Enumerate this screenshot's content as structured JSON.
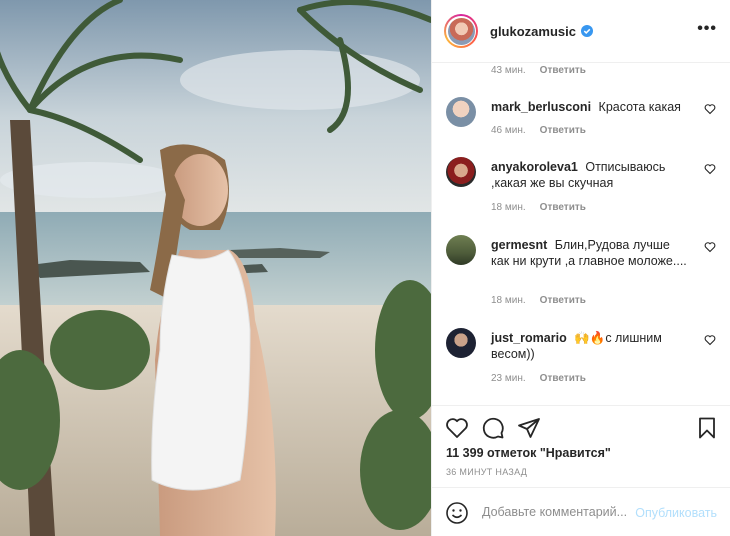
{
  "post": {
    "image_alt": "beach photo",
    "colors": {
      "sky": "#aebfcc",
      "sea": "#9fb5bc",
      "sand": "#d8cfc2",
      "swimsuit": "#f4f4f4"
    }
  },
  "header": {
    "username": "glukozamusic",
    "verified_icon": "verified-badge-icon",
    "more_icon": "more-options-icon",
    "more_glyph": "•••"
  },
  "comments": {
    "top_item": {
      "time": "43 мин.",
      "reply": "Ответить"
    },
    "items": [
      {
        "user": "mark_berlusconi",
        "text": "Красота какая",
        "time": "46 мин.",
        "reply": "Ответить"
      },
      {
        "user": "anyakoroleva1",
        "text": "Отписываюсь ,какая же вы скучная",
        "time": "18 мин.",
        "reply": "Ответить"
      },
      {
        "user": "germesnt",
        "text": "Блин,Рудова лучше как ни крути ,а главное моложе....",
        "time": "18 мин.",
        "reply": "Ответить"
      },
      {
        "user": "just_romario",
        "text": "🙌🔥с лишним весом))",
        "time": "23 мин.",
        "reply": "Ответить"
      }
    ]
  },
  "actions": {
    "like_icon": "heart-icon",
    "comment_icon": "comment-icon",
    "share_icon": "share-icon",
    "save_icon": "bookmark-icon",
    "likes": "11 399 отметок \"Нравится\"",
    "time": "36 МИНУТ НАЗАД"
  },
  "add_comment": {
    "emoji_icon": "emoji-icon",
    "placeholder": "Добавьте комментарий...",
    "post_label": "Опубликовать"
  }
}
